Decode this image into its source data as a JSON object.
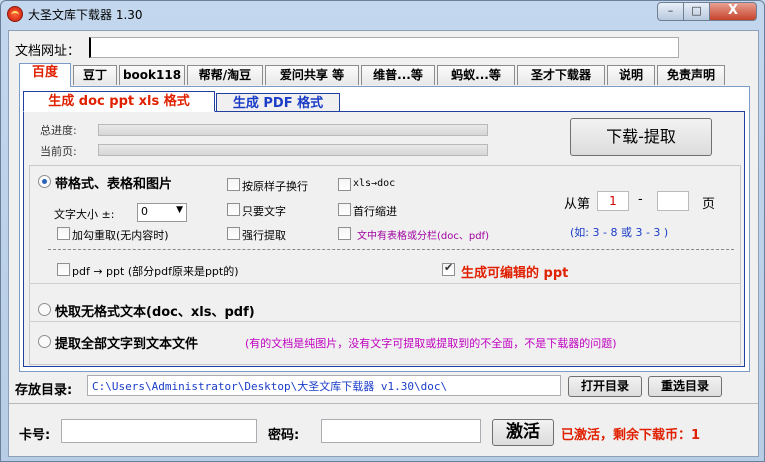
{
  "window": {
    "title": "大圣文库下载器 1.30",
    "min_glyph": "–",
    "max_glyph": "□",
    "close_glyph": "X"
  },
  "url_row": {
    "label": "文档网址：",
    "value": ""
  },
  "tabs": [
    {
      "label": "百度"
    },
    {
      "label": "豆丁"
    },
    {
      "label": "book118"
    },
    {
      "label": "帮帮/淘豆"
    },
    {
      "label": "爱问共享 等"
    },
    {
      "label": "维普...等"
    },
    {
      "label": "蚂蚁...等"
    },
    {
      "label": "圣才下载器"
    },
    {
      "label": "说明"
    },
    {
      "label": "免责声明"
    }
  ],
  "subtabs": [
    {
      "label": "生成 doc ppt xls 格式"
    },
    {
      "label": "生成 PDF 格式"
    }
  ],
  "progress": {
    "total_label": "总进度:",
    "total_value": 0,
    "page_label": "当前页:",
    "page_value": 0
  },
  "download_button": "下载-提取",
  "options": {
    "mode_formatted": "带格式、表格和图片",
    "font_size_label": "文字大小 ±:",
    "font_size_value": "0",
    "chk_layout": "按原样子换行",
    "chk_text_only": "只要文字",
    "chk_force": "强行提取",
    "chk_xls_doc": "xls→doc",
    "chk_indent": "首行缩进",
    "chk_table": "文中有表格或分栏(doc、pdf)",
    "chk_reget": "加勾重取(无内容时)",
    "page_from": "从第",
    "page_start": "1",
    "page_dash": "-",
    "page_end": "",
    "page_unit": "页",
    "page_example": "(如: 3 - 8  或 3 - 3 )",
    "pdf_ppt": "pdf → ppt (部分pdf原来是ppt的)",
    "editable_ppt": "生成可编辑的 ppt",
    "mode_plain": "快取无格式文本(doc、xls、pdf)",
    "mode_all": "提取全部文字到文本文件",
    "mode_all_note": "(有的文档是纯图片，没有文字可提取或提取到的不全面，不是下载器的问题)"
  },
  "save_row": {
    "label": "存放目录:",
    "path": "C:\\Users\\Administrator\\Desktop\\大圣文库下载器 v1.30\\doc\\",
    "open_button": "打开目录",
    "reselect_button": "重选目录"
  },
  "activation": {
    "card_label": "卡号:",
    "card_value": "",
    "password_label": "密码:",
    "password_value": "",
    "activate_button": "激活",
    "status": "已激活，剩余下载币：1"
  },
  "colors": {
    "accent_red": "#e02000",
    "accent_blue": "#1a3cc8",
    "note_magenta": "#c000c0",
    "progress_green": "#34b22c"
  }
}
